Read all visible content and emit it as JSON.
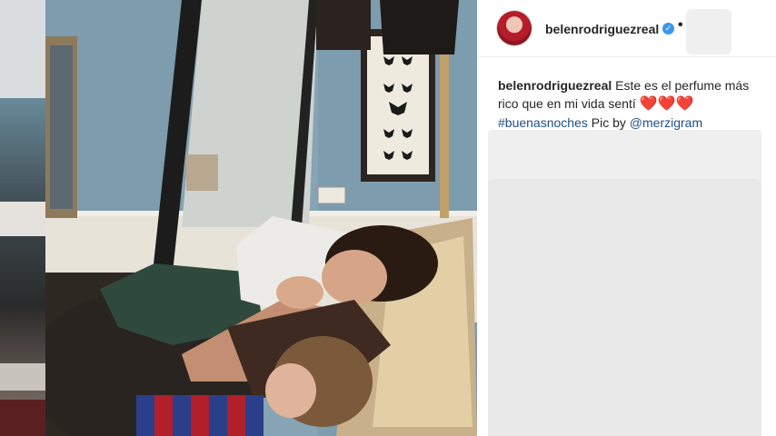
{
  "post": {
    "username": "belenrodriguezreal",
    "verified_icon": "verified-badge-icon",
    "separator": "•"
  },
  "caption": {
    "username": "belenrodriguezreal",
    "text": "Este es el perfume más rico que en mi vida sentí",
    "hearts": "❤️❤️❤️",
    "hashtag": "#buenasnoches",
    "credit_prefix": "Pic by",
    "mention": "@merzigram"
  },
  "colors": {
    "link": "#1f4f86",
    "text": "#262626",
    "verified": "#3897f0",
    "placeholder": "#efefef"
  }
}
